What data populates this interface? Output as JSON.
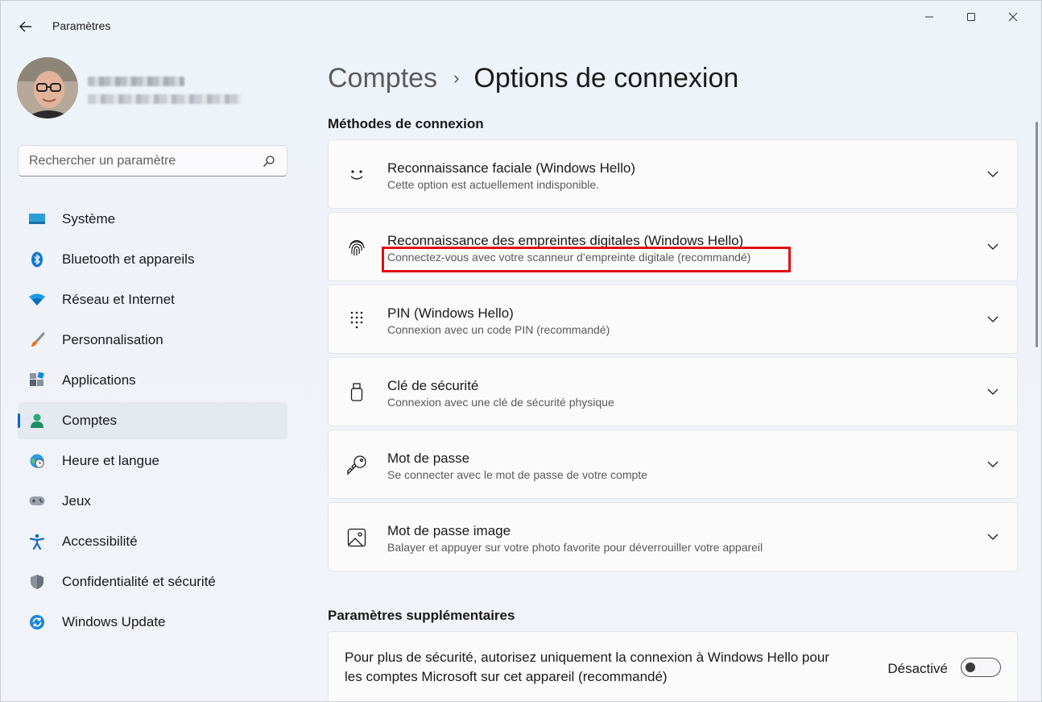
{
  "app": {
    "title": "Paramètres"
  },
  "search": {
    "placeholder": "Rechercher un paramètre"
  },
  "sidebar": {
    "items": [
      {
        "label": "Système",
        "icon": "monitor-icon"
      },
      {
        "label": "Bluetooth et appareils",
        "icon": "bluetooth-icon"
      },
      {
        "label": "Réseau et Internet",
        "icon": "wifi-icon"
      },
      {
        "label": "Personnalisation",
        "icon": "paintbrush-icon"
      },
      {
        "label": "Applications",
        "icon": "apps-icon"
      },
      {
        "label": "Comptes",
        "icon": "account-icon",
        "active": true
      },
      {
        "label": "Heure et langue",
        "icon": "globe-clock-icon"
      },
      {
        "label": "Jeux",
        "icon": "gamepad-icon"
      },
      {
        "label": "Accessibilité",
        "icon": "accessibility-icon"
      },
      {
        "label": "Confidentialité et sécurité",
        "icon": "shield-icon"
      },
      {
        "label": "Windows Update",
        "icon": "update-icon"
      }
    ]
  },
  "breadcrumb": {
    "parent": "Comptes",
    "separator": "›",
    "current": "Options de connexion"
  },
  "sections": {
    "methods_title": "Méthodes de connexion",
    "extra_title": "Paramètres supplémentaires"
  },
  "methods": [
    {
      "title": "Reconnaissance faciale (Windows Hello)",
      "subtitle": "Cette option est actuellement indisponible.",
      "icon": "smiley-face-icon"
    },
    {
      "title": "Reconnaissance des empreintes digitales (Windows Hello)",
      "subtitle": "Connectez-vous avec votre scanneur d’empreinte digitale (recommandé)",
      "icon": "fingerprint-icon",
      "highlighted": true
    },
    {
      "title": "PIN (Windows Hello)",
      "subtitle": "Connexion avec un code PIN (recommandé)",
      "icon": "keypad-icon"
    },
    {
      "title": "Clé de sécurité",
      "subtitle": "Connexion avec une clé de sécurité physique",
      "icon": "usb-key-icon"
    },
    {
      "title": "Mot de passe",
      "subtitle": "Se connecter avec le mot de passe de votre compte",
      "icon": "key-icon"
    },
    {
      "title": "Mot de passe image",
      "subtitle": "Balayer et appuyer sur votre photo favorite pour déverrouiller votre appareil",
      "icon": "picture-icon"
    }
  ],
  "extra": {
    "text": "Pour plus de sécurité, autorisez uniquement la connexion à Windows Hello pour les comptes Microsoft sur cet appareil (recommandé)",
    "toggle_label": "Désactivé",
    "toggle_on": false
  },
  "colors": {
    "accent": "#0067c0",
    "highlight": "#e01010"
  }
}
